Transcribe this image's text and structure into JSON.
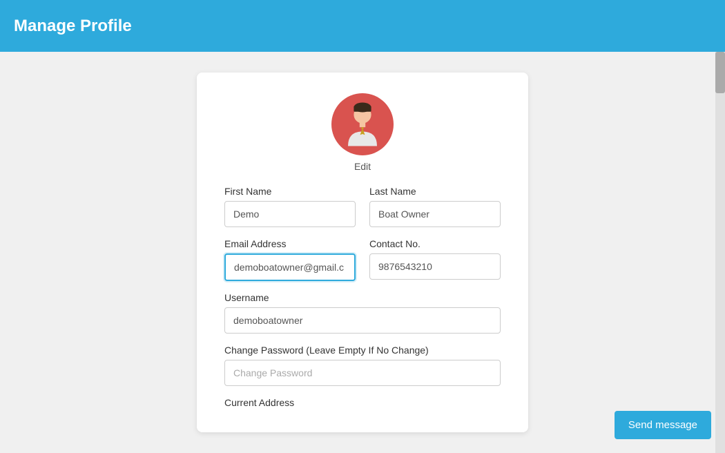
{
  "header": {
    "title": "Manage Profile"
  },
  "form": {
    "avatar_alt": "User Avatar",
    "edit_label": "Edit",
    "first_name_label": "First Name",
    "first_name_value": "Demo",
    "last_name_label": "Last Name",
    "last_name_value": "Boat Owner",
    "email_label": "Email Address",
    "email_value": "demoboatowner@gmail.c",
    "contact_label": "Contact No.",
    "contact_value": "9876543210",
    "username_label": "Username",
    "username_value": "demoboatowner",
    "password_label": "Change Password (Leave Empty If No Change)",
    "password_placeholder": "Change Password",
    "address_label": "Current Address"
  },
  "buttons": {
    "send_message": "Send message"
  }
}
